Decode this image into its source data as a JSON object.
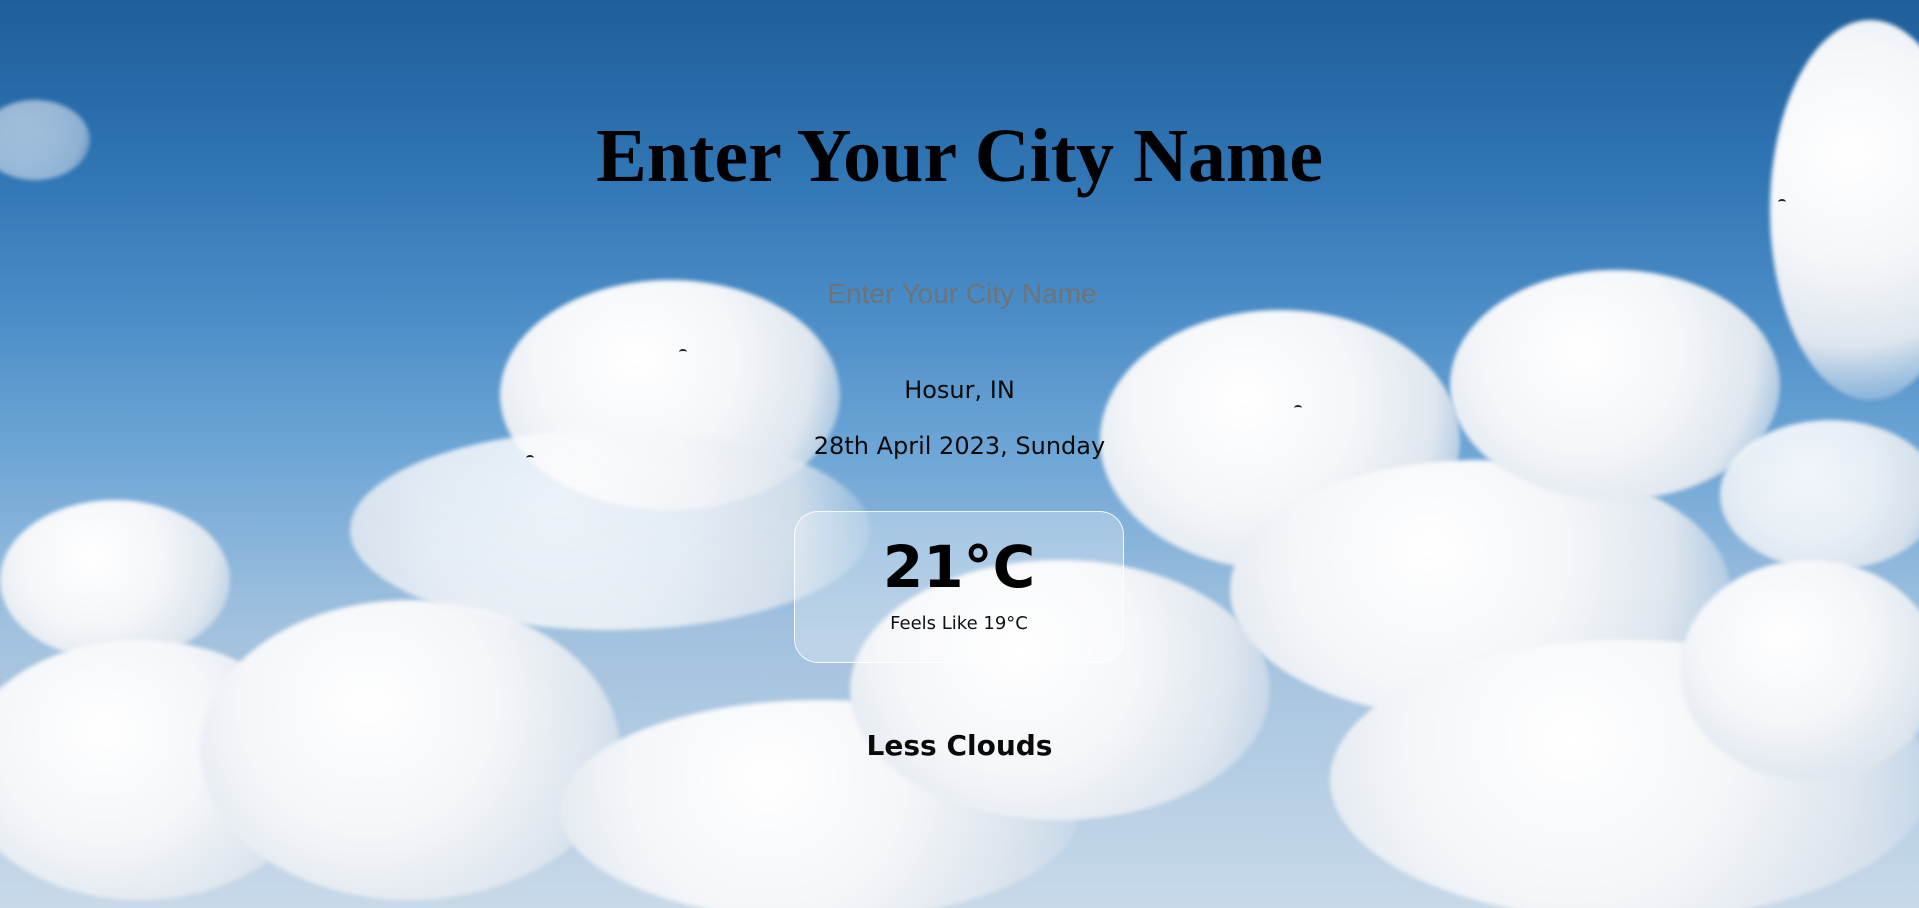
{
  "page": {
    "title": "Enter Your City Name"
  },
  "search": {
    "placeholder": "Enter Your City Name",
    "value": ""
  },
  "weather": {
    "location": "Hosur, IN",
    "date": "28th April 2023, Sunday",
    "temperature": "21°C",
    "feels_like": "Feels Like 19°C",
    "condition": "Less Clouds"
  },
  "background": {
    "kind": "sky-with-clouds",
    "sky_color": "#2f74b3",
    "cloud_color": "#f4f6f9"
  },
  "card": {
    "border_color": "#ffffff"
  }
}
